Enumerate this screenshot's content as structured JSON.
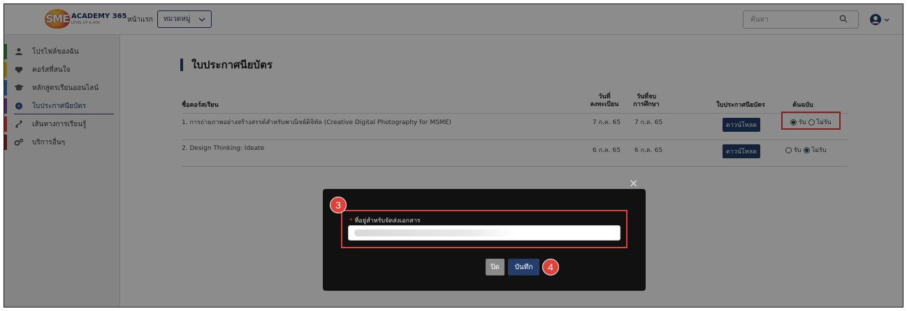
{
  "header": {
    "logo_badge": "SME",
    "logo_title": "ACADEMY 365",
    "logo_sub": "LEVEL UP & WIN",
    "home_label": "หน้าแรก",
    "category_label": "หมวดหมู่",
    "search_placeholder": "ค้นหา"
  },
  "sidebar": {
    "items": [
      {
        "label": "โปรไฟล์ของฉัน",
        "icon": "user-icon",
        "color": "#3c8a3c"
      },
      {
        "label": "คอร์สที่สนใจ",
        "icon": "heart-icon",
        "color": "#e8c21a"
      },
      {
        "label": "หลักสูตรเรียนออนไลน์",
        "icon": "graduation-cap-icon",
        "color": "#2a7ab8"
      },
      {
        "label": "ใบประกาศนียบัตร",
        "icon": "certificate-icon",
        "color": "#7b3fa0"
      },
      {
        "label": "เส้นทางการเรียนรู้",
        "icon": "route-icon",
        "color": "#e0403a"
      },
      {
        "label": "บริการอื่นๆ",
        "icon": "cogs-icon",
        "color": "#8a2a2a"
      }
    ]
  },
  "main": {
    "title": "ใบประกาศนียบัตร",
    "columns": {
      "course": "ชื่อคอร์สเรียน",
      "register_date_1": "วันที่",
      "register_date_2": "ลงทะเบียน",
      "finish_date_1": "วันที่จบ",
      "finish_date_2": "การศึกษา",
      "certificate": "ใบประกาศนียบัตร",
      "original": "ต้นฉบับ"
    },
    "rows": [
      {
        "course": "1. การถ่ายภาพอย่างสร้างสรรค์สำหรับพาณิชย์ดิจิทัล (Creative Digital Photography for MSME)",
        "register_date": "7 ก.ค. 65",
        "finish_date": "7 ก.ค. 65",
        "download_label": "ดาวน์โหลด",
        "receive_label": "รับ",
        "not_receive_label": "ไม่รับ",
        "selected": "receive"
      },
      {
        "course": "2. Design Thinking: Ideate",
        "register_date": "6 ก.ค. 65",
        "finish_date": "6 ก.ค. 65",
        "download_label": "ดาวน์โหลด",
        "receive_label": "รับ",
        "not_receive_label": "ไม่รับ",
        "selected": "not_receive"
      }
    ]
  },
  "modal": {
    "close_x": "×",
    "required_mark": "*",
    "field_label": "ที่อยู่สำหรับจัดส่งเอกสาร",
    "close_button": "ปิด",
    "save_button": "บันทึก",
    "step_3": "3",
    "step_4": "4"
  },
  "colors": {
    "primary": "#243d6b",
    "highlight": "#e0403a"
  }
}
